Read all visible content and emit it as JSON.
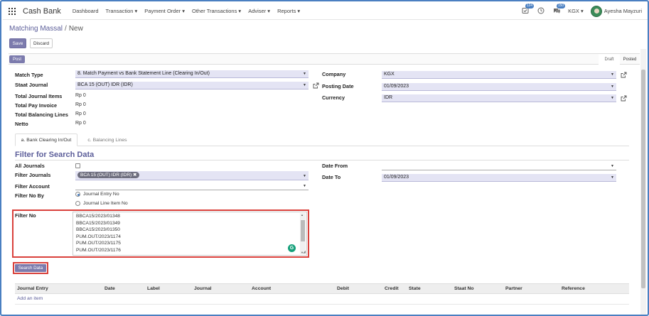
{
  "navbar": {
    "app_title": "Cash Bank",
    "menu": [
      "Dashboard",
      "Transaction ▾",
      "Payment Order ▾",
      "Other Transactions ▾",
      "Adviser ▾",
      "Reports ▾"
    ],
    "activity_badge": "124",
    "messages_badge": "150",
    "company_switch": "KGX ▾",
    "user_name": "Ayesha Mayzuri"
  },
  "breadcrumb": {
    "parent": "Matching Massal",
    "separator": "/",
    "current": "New"
  },
  "buttons": {
    "save": "Save",
    "discard": "Discard",
    "post": "Post",
    "search_data": "Search Data"
  },
  "status": {
    "draft": "Draft",
    "posted": "Posted"
  },
  "form": {
    "match_type_label": "Match Type",
    "match_type_value": "8. Match Payment vs Bank Statement Line (Clearing In/Out)",
    "staat_journal_label": "Staat Journal",
    "staat_journal_value": "BCA 15 (OUT) IDR (IDR)",
    "total_journal_items_label": "Total Journal Items",
    "total_journal_items_value": "Rp 0",
    "total_pay_invoice_label": "Total Pay Invoice",
    "total_pay_invoice_value": "Rp 0",
    "total_balancing_lines_label": "Total Balancing Lines",
    "total_balancing_lines_value": "Rp 0",
    "netto_label": "Netto",
    "netto_value": "Rp 0",
    "company_label": "Company",
    "company_value": "KGX",
    "posting_date_label": "Posting Date",
    "posting_date_value": "01/09/2023",
    "currency_label": "Currency",
    "currency_value": "IDR"
  },
  "tabs": [
    "a. Bank Clearing In/Out",
    "c. Balancing Lines"
  ],
  "filter": {
    "title": "Filter for Search Data",
    "all_journals_label": "All Journals",
    "all_journals_checked": false,
    "filter_journals_label": "Filter Journals",
    "filter_journals_tag": "BCA 15 (OUT) IDR (IDR) ✖",
    "filter_account_label": "Filter Account",
    "filter_no_by_label": "Filter No By",
    "filter_no_by_options": [
      "Journal Entry No",
      "Journal Line Item No"
    ],
    "filter_no_by_selected": "Journal Entry No",
    "filter_no_label": "Filter No",
    "filter_no_lines": [
      "BBCA15/2023/01348",
      "BBCA15/2023/01349",
      "BBCA15/2023/01350",
      "PUM.OUT/2023/1174",
      "PUM.OUT/2023/1175",
      "PUM.OUT/2023/1176"
    ],
    "date_from_label": "Date From",
    "date_from_value": "",
    "date_to_label": "Date To",
    "date_to_value": "01/09/2023"
  },
  "table": {
    "columns": [
      "Journal Entry",
      "Date",
      "Label",
      "Journal",
      "Account",
      "Debit",
      "Credit",
      "State",
      "Staat No",
      "Partner",
      "Reference"
    ],
    "add_item": "Add an item"
  },
  "icons": {
    "apps": "apps-grid-icon",
    "activity": "activity-icon",
    "clock": "clock-icon",
    "messages": "chat-icon",
    "external_link": "external-link-icon",
    "grammarly": "grammarly-icon"
  },
  "colors": {
    "primary": "#7c7bad",
    "link": "#5b5d99",
    "highlight_box": "#d9403b",
    "select_bg": "#e4e4f4",
    "frame": "#4a7fc1"
  }
}
